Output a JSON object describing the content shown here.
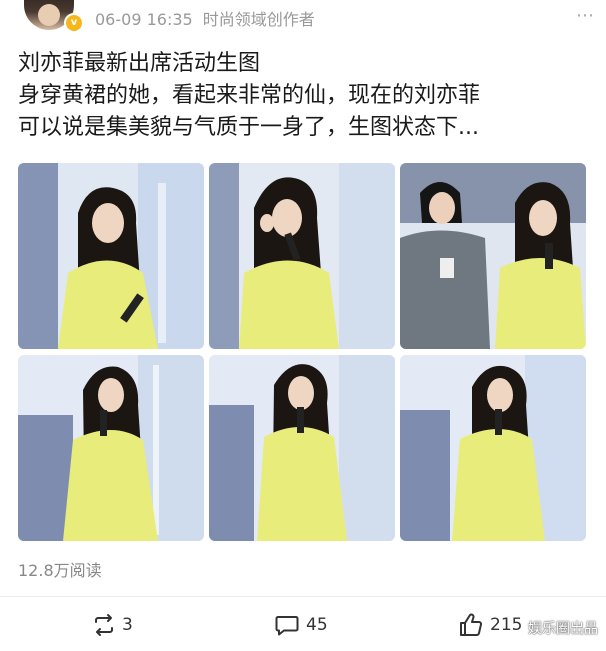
{
  "post": {
    "date": "06-09 16:35",
    "source_label": "时尚领域创作者",
    "text_lines": [
      "刘亦菲最新出席活动生图",
      "身穿黄裙的她，看起来非常的仙，现在的刘亦菲",
      "可以说是集美貌与气质于一身了，生图状态下..."
    ],
    "views": "12.8万阅读"
  },
  "author": {
    "verified_badge": "v"
  },
  "photos": [
    {
      "alt": "photo-1"
    },
    {
      "alt": "photo-2"
    },
    {
      "alt": "photo-3"
    },
    {
      "alt": "photo-4"
    },
    {
      "alt": "photo-5"
    },
    {
      "alt": "photo-6"
    }
  ],
  "actions": {
    "repost_count": "3",
    "comment_count": "45",
    "like_count": "215"
  },
  "watermark": "娱乐圈出品",
  "colors": {
    "dress_yellow": "#e8ec7a",
    "badge_gold": "#f5b71a",
    "meta_gray": "#999999"
  },
  "icons": {
    "repost": "repost-icon",
    "comment": "comment-icon",
    "like": "like-icon",
    "more": "more-icon"
  }
}
